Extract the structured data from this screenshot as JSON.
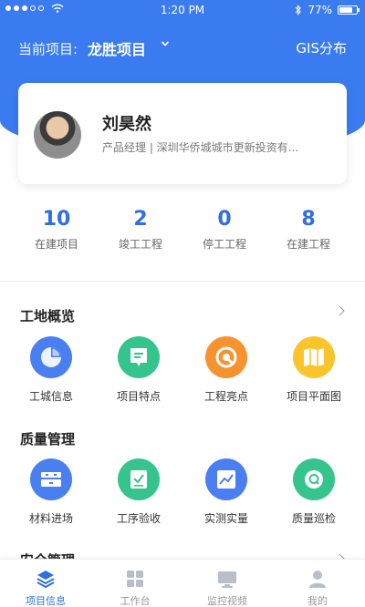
{
  "status_bar": {
    "time": "1:20 PM",
    "battery": "77%",
    "battery_level": 0.77
  },
  "header": {
    "project_prefix": "当前项目:",
    "project_name": "龙胜项目",
    "gis_label": "GIS分布"
  },
  "profile": {
    "name": "刘昊然",
    "role": "产品经理 | 深圳华侨城城市更新投资有..."
  },
  "stats": [
    {
      "value": "10",
      "label": "在建项目"
    },
    {
      "value": "2",
      "label": "竣工工程"
    },
    {
      "value": "0",
      "label": "停工工程"
    },
    {
      "value": "8",
      "label": "在建工程"
    }
  ],
  "sections": [
    {
      "title": "工地概览",
      "items": [
        {
          "label": "工城信息",
          "icon": "pie-chart-icon",
          "color": "#4a7ff2"
        },
        {
          "label": "项目特点",
          "icon": "bookmark-icon",
          "color": "#36c48e"
        },
        {
          "label": "工程亮点",
          "icon": "highlight-icon",
          "color": "#f7932e"
        },
        {
          "label": "项目平面图",
          "icon": "map-icon",
          "color": "#f9c52b"
        }
      ]
    },
    {
      "title": "质量管理",
      "items": [
        {
          "label": "材料进场",
          "icon": "materials-icon",
          "color": "#4a7ff2"
        },
        {
          "label": "工序验收",
          "icon": "checklist-icon",
          "color": "#36c48e"
        },
        {
          "label": "实测实量",
          "icon": "line-chart-icon",
          "color": "#4a7ff2"
        },
        {
          "label": "质量巡检",
          "icon": "inspect-icon",
          "color": "#36c48e"
        }
      ]
    },
    {
      "title": "安全管理"
    }
  ],
  "tabs": [
    {
      "label": "项目信息",
      "icon": "layers-icon",
      "active": true
    },
    {
      "label": "工作台",
      "icon": "grid-icon",
      "active": false
    },
    {
      "label": "监控视频",
      "icon": "monitor-icon",
      "active": false
    },
    {
      "label": "我的",
      "icon": "user-icon",
      "active": false
    }
  ]
}
